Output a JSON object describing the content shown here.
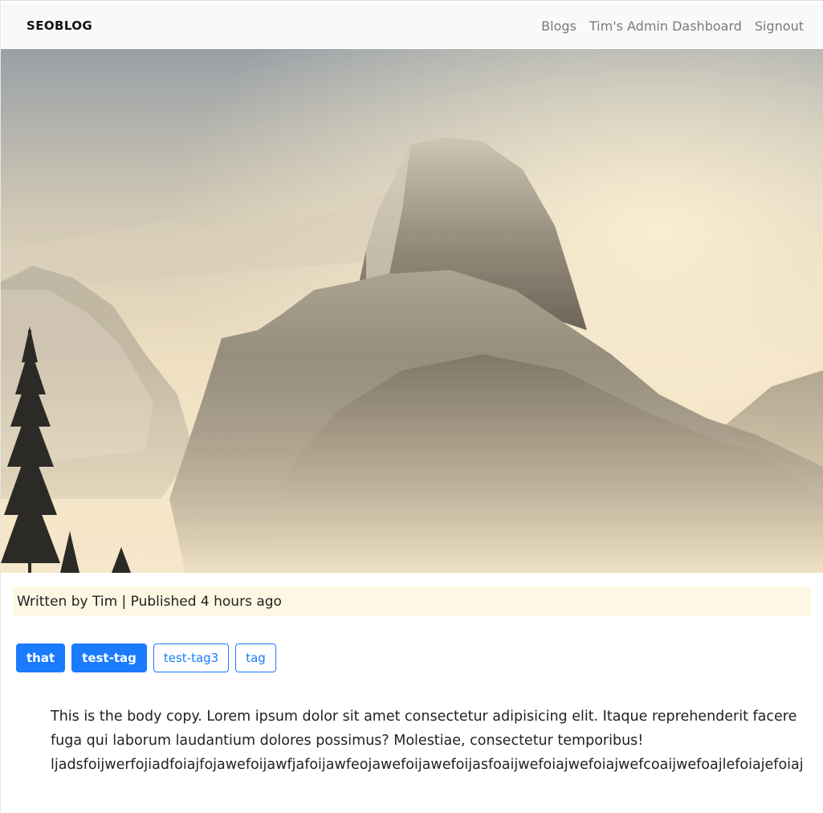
{
  "navbar": {
    "brand": "SEOBLOG",
    "links": [
      "Blogs",
      "Tim's Admin Dashboard",
      "Signout"
    ]
  },
  "hero": {
    "icon": "mountain-photo"
  },
  "meta": {
    "text": "Written by Tim | Published 4 hours ago"
  },
  "tags": [
    {
      "label": "that",
      "style": "solid"
    },
    {
      "label": "test-tag",
      "style": "solid"
    },
    {
      "label": "test-tag3",
      "style": "outline"
    },
    {
      "label": "tag",
      "style": "outline"
    }
  ],
  "body": {
    "lines": [
      "This is the body copy. Lorem ipsum dolor sit amet consectetur adipisicing elit. Itaque reprehenderit facere",
      "fuga qui laborum laudantium dolores possimus? Molestiae, consectetur temporibus!",
      "ljadsfoijwerfojiadfoiajfojawefoijawfjafoijawfeojawefoijawefoijasfoaijwefoiajwefoiajwefcoaijwefoajlefoiajefoiaj"
    ]
  },
  "colors": {
    "accent": "#1a7bff",
    "meta_bg": "#fdf7e3",
    "navbar_bg": "#f8f9fa"
  }
}
